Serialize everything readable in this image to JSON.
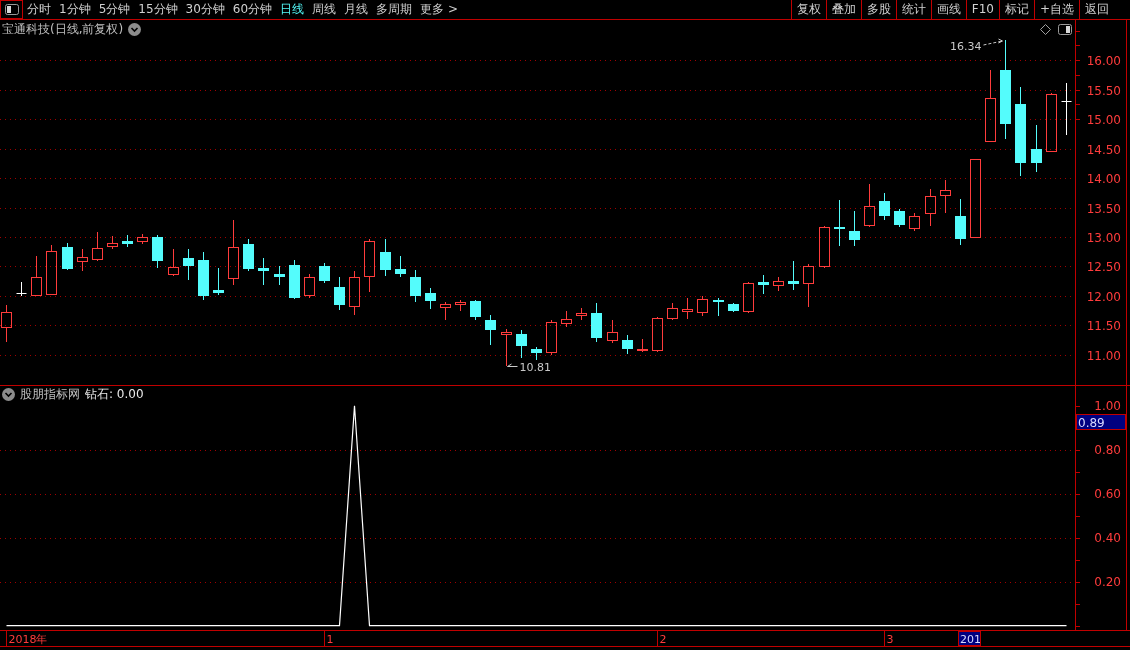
{
  "toolbar": {
    "tabs": [
      {
        "label": "分时",
        "selected": false
      },
      {
        "label": "1分钟",
        "selected": false
      },
      {
        "label": "5分钟",
        "selected": false
      },
      {
        "label": "15分钟",
        "selected": false
      },
      {
        "label": "30分钟",
        "selected": false
      },
      {
        "label": "60分钟",
        "selected": false
      },
      {
        "label": "日线",
        "selected": true
      },
      {
        "label": "周线",
        "selected": false
      },
      {
        "label": "月线",
        "selected": false
      },
      {
        "label": "多周期",
        "selected": false
      },
      {
        "label": "更多 >",
        "selected": false
      }
    ],
    "buttons": [
      "复权",
      "叠加",
      "多股",
      "统计",
      "画线",
      "F10",
      "标记",
      "+自选",
      "返回"
    ]
  },
  "price_chart": {
    "title": "宝通科技(日线,前复权)",
    "chart_data": {
      "type": "candlestick",
      "ohlc": [
        [
          11.46,
          11.85,
          11.22,
          11.73
        ],
        [
          12.05,
          12.24,
          12.0,
          12.05
        ],
        [
          12.0,
          12.68,
          12.0,
          12.32
        ],
        [
          12.02,
          12.86,
          12.02,
          12.76
        ],
        [
          12.83,
          12.9,
          12.44,
          12.46
        ],
        [
          12.58,
          12.8,
          12.42,
          12.66
        ],
        [
          12.61,
          13.08,
          12.59,
          12.81
        ],
        [
          12.83,
          13.02,
          12.8,
          12.9
        ],
        [
          12.93,
          13.03,
          12.83,
          12.88
        ],
        [
          12.92,
          13.05,
          12.88,
          13.0
        ],
        [
          13.0,
          13.03,
          12.47,
          12.59
        ],
        [
          12.36,
          12.8,
          12.34,
          12.49
        ],
        [
          12.64,
          12.8,
          12.27,
          12.51
        ],
        [
          12.61,
          12.75,
          11.93,
          12.0
        ],
        [
          12.1,
          12.47,
          12.02,
          12.05
        ],
        [
          12.29,
          13.29,
          12.19,
          12.83
        ],
        [
          12.88,
          12.97,
          12.42,
          12.46
        ],
        [
          12.47,
          12.64,
          12.19,
          12.42
        ],
        [
          12.37,
          12.51,
          12.19,
          12.32
        ],
        [
          12.53,
          12.61,
          11.95,
          11.97
        ],
        [
          12.0,
          12.37,
          11.97,
          12.32
        ],
        [
          12.51,
          12.56,
          12.22,
          12.25
        ],
        [
          12.15,
          12.32,
          11.76,
          11.85
        ],
        [
          11.81,
          12.42,
          11.68,
          12.32
        ],
        [
          12.32,
          12.97,
          12.07,
          12.93
        ],
        [
          12.75,
          12.97,
          12.34,
          12.44
        ],
        [
          12.46,
          12.68,
          12.32,
          12.37
        ],
        [
          12.32,
          12.44,
          11.9,
          12.0
        ],
        [
          12.05,
          12.14,
          11.78,
          11.92
        ],
        [
          11.8,
          11.9,
          11.59,
          11.86
        ],
        [
          11.85,
          11.93,
          11.75,
          11.9
        ],
        [
          11.92,
          11.93,
          11.59,
          11.64
        ],
        [
          11.59,
          11.68,
          11.17,
          11.42
        ],
        [
          11.34,
          11.44,
          10.81,
          11.39
        ],
        [
          11.36,
          11.42,
          10.95,
          11.15
        ],
        [
          11.1,
          11.14,
          10.92,
          11.03
        ],
        [
          11.03,
          11.59,
          11.0,
          11.56
        ],
        [
          11.53,
          11.75,
          11.47,
          11.61
        ],
        [
          11.66,
          11.8,
          11.59,
          11.71
        ],
        [
          11.71,
          11.88,
          11.22,
          11.29
        ],
        [
          11.24,
          11.59,
          11.2,
          11.39
        ],
        [
          11.25,
          11.34,
          11.02,
          11.1
        ],
        [
          11.07,
          11.27,
          11.05,
          11.1
        ],
        [
          11.07,
          11.64,
          11.05,
          11.63
        ],
        [
          11.61,
          11.88,
          11.59,
          11.8
        ],
        [
          11.73,
          11.97,
          11.61,
          11.78
        ],
        [
          11.71,
          12.0,
          11.66,
          11.95
        ],
        [
          11.93,
          11.97,
          11.66,
          11.9
        ],
        [
          11.86,
          11.88,
          11.73,
          11.75
        ],
        [
          11.73,
          12.24,
          11.71,
          12.22
        ],
        [
          12.24,
          12.36,
          12.03,
          12.19
        ],
        [
          12.17,
          12.32,
          12.08,
          12.25
        ],
        [
          12.25,
          12.59,
          12.1,
          12.2
        ],
        [
          12.2,
          12.54,
          11.81,
          12.51
        ],
        [
          12.49,
          13.19,
          12.47,
          13.17
        ],
        [
          13.17,
          13.63,
          12.85,
          13.14
        ],
        [
          13.1,
          13.44,
          12.85,
          12.95
        ],
        [
          13.19,
          13.9,
          13.17,
          13.53
        ],
        [
          13.61,
          13.75,
          13.29,
          13.36
        ],
        [
          13.44,
          13.47,
          13.17,
          13.2
        ],
        [
          13.14,
          13.41,
          13.1,
          13.36
        ],
        [
          13.39,
          13.81,
          13.19,
          13.69
        ],
        [
          13.69,
          13.97,
          13.41,
          13.8
        ],
        [
          13.36,
          13.64,
          12.86,
          12.97
        ],
        [
          12.98,
          14.32,
          12.98,
          14.32
        ],
        [
          14.61,
          15.83,
          14.61,
          15.36
        ],
        [
          15.83,
          16.34,
          14.66,
          14.92
        ],
        [
          15.25,
          15.54,
          14.03,
          14.25
        ],
        [
          14.49,
          14.9,
          14.1,
          14.25
        ],
        [
          14.44,
          15.44,
          14.44,
          15.42
        ],
        [
          15.31,
          15.61,
          14.73,
          15.31
        ]
      ],
      "ylim": [
        10.49,
        16.68
      ],
      "yticks": [
        {
          "value": 16,
          "label": "16.00"
        },
        {
          "value": 15.5,
          "label": "15.50"
        },
        {
          "value": 15,
          "label": "15.00"
        },
        {
          "value": 14.5,
          "label": "14.50"
        },
        {
          "value": 14,
          "label": "14.00"
        },
        {
          "value": 13.5,
          "label": "13.50"
        },
        {
          "value": 13,
          "label": "13.00"
        },
        {
          "value": 12.5,
          "label": "12.50"
        },
        {
          "value": 12,
          "label": "12.00"
        },
        {
          "value": 11.5,
          "label": "11.50"
        },
        {
          "value": 11,
          "label": "11.00"
        }
      ],
      "grid": true,
      "annotations": [
        "16.34",
        "10.81"
      ]
    }
  },
  "indicator": {
    "name": "股朋指标网",
    "legend": "钻石: 0.00",
    "cursor_value_label": "0.89",
    "chart_data": {
      "type": "line",
      "values": [
        0,
        0,
        0,
        0,
        0,
        0,
        0,
        0,
        0,
        0,
        0,
        0,
        0,
        0,
        0,
        0,
        0,
        0,
        0,
        0,
        0,
        0,
        0,
        1,
        0,
        0,
        0,
        0,
        0,
        0,
        0,
        0,
        0,
        0,
        0,
        0,
        0,
        0,
        0,
        0,
        0,
        0,
        0,
        0,
        0,
        0,
        0,
        0,
        0,
        0,
        0,
        0,
        0,
        0,
        0,
        0,
        0,
        0,
        0,
        0,
        0,
        0,
        0,
        0,
        0,
        0,
        0,
        0,
        0,
        0,
        0
      ],
      "ylim": [
        -0.02,
        1.09
      ],
      "yticks": [
        {
          "value": 1,
          "label": "1.00"
        },
        {
          "value": 0.8,
          "label": "0.80"
        },
        {
          "value": 0.6,
          "label": "0.60"
        },
        {
          "value": 0.4,
          "label": "0.40"
        },
        {
          "value": 0.2,
          "label": "0.20"
        }
      ],
      "grid": true
    }
  },
  "time_axis": {
    "labels": [
      "2018年",
      "1",
      "2",
      "3"
    ],
    "cursor_label": "201"
  }
}
